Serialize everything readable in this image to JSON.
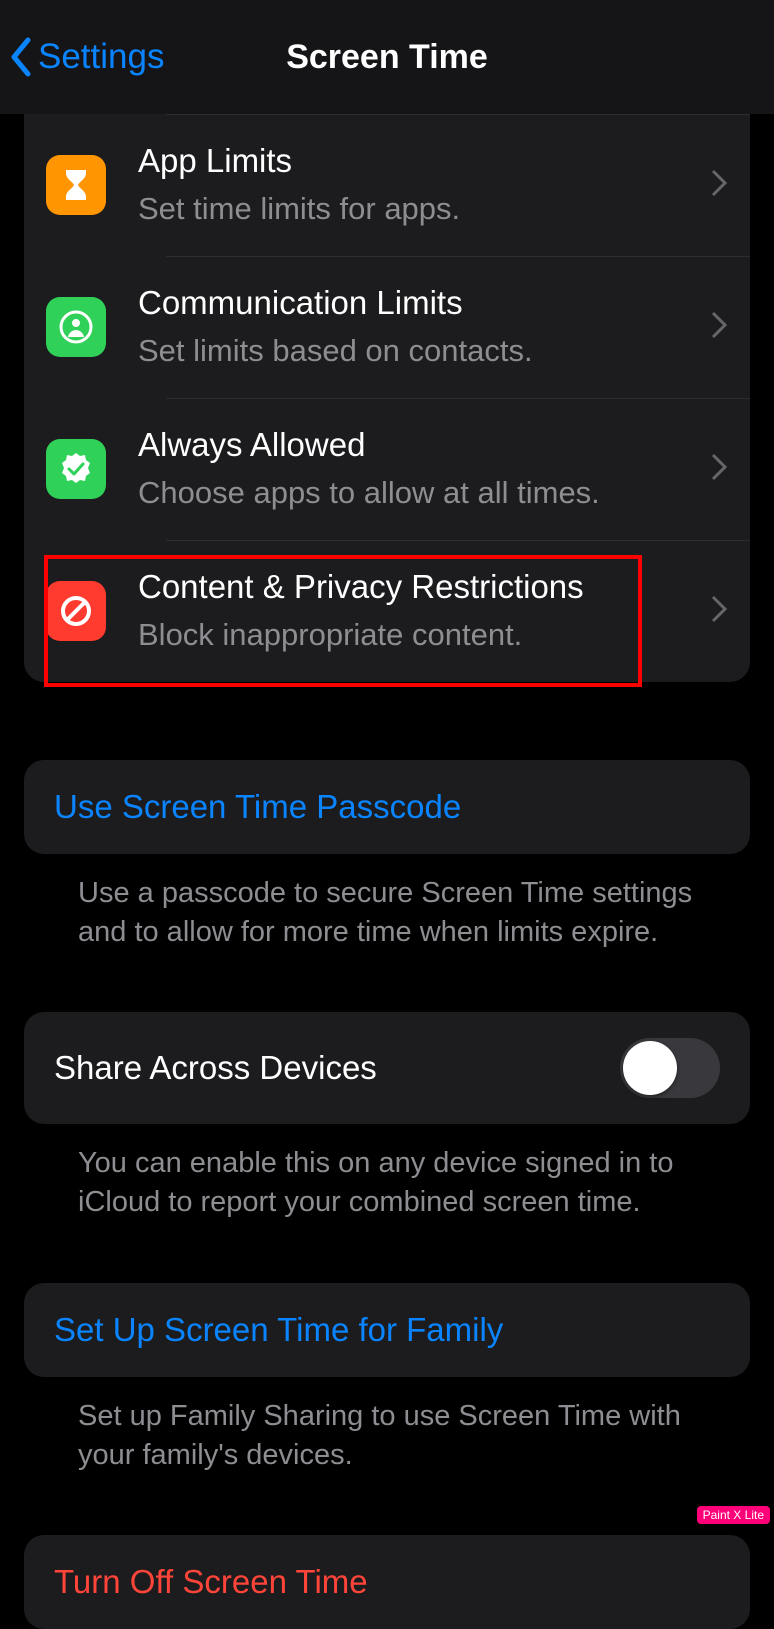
{
  "nav": {
    "back": "Settings",
    "title": "Screen Time"
  },
  "rows": [
    {
      "title": "App Limits",
      "sub": "Set time limits for apps."
    },
    {
      "title": "Communication Limits",
      "sub": "Set limits based on contacts."
    },
    {
      "title": "Always Allowed",
      "sub": "Choose apps to allow at all times."
    },
    {
      "title": "Content & Privacy Restrictions",
      "sub": "Block inappropriate content."
    }
  ],
  "passcode": {
    "label": "Use Screen Time Passcode",
    "hint": "Use a passcode to secure Screen Time settings and to allow for more time when limits expire."
  },
  "share": {
    "label": "Share Across Devices",
    "hint": "You can enable this on any device signed in to iCloud to report your combined screen time."
  },
  "family": {
    "label": "Set Up Screen Time for Family",
    "hint": "Set up Family Sharing to use Screen Time with your family's devices."
  },
  "turnoff": {
    "label": "Turn Off Screen Time"
  },
  "watermark": "Paint X Lite"
}
